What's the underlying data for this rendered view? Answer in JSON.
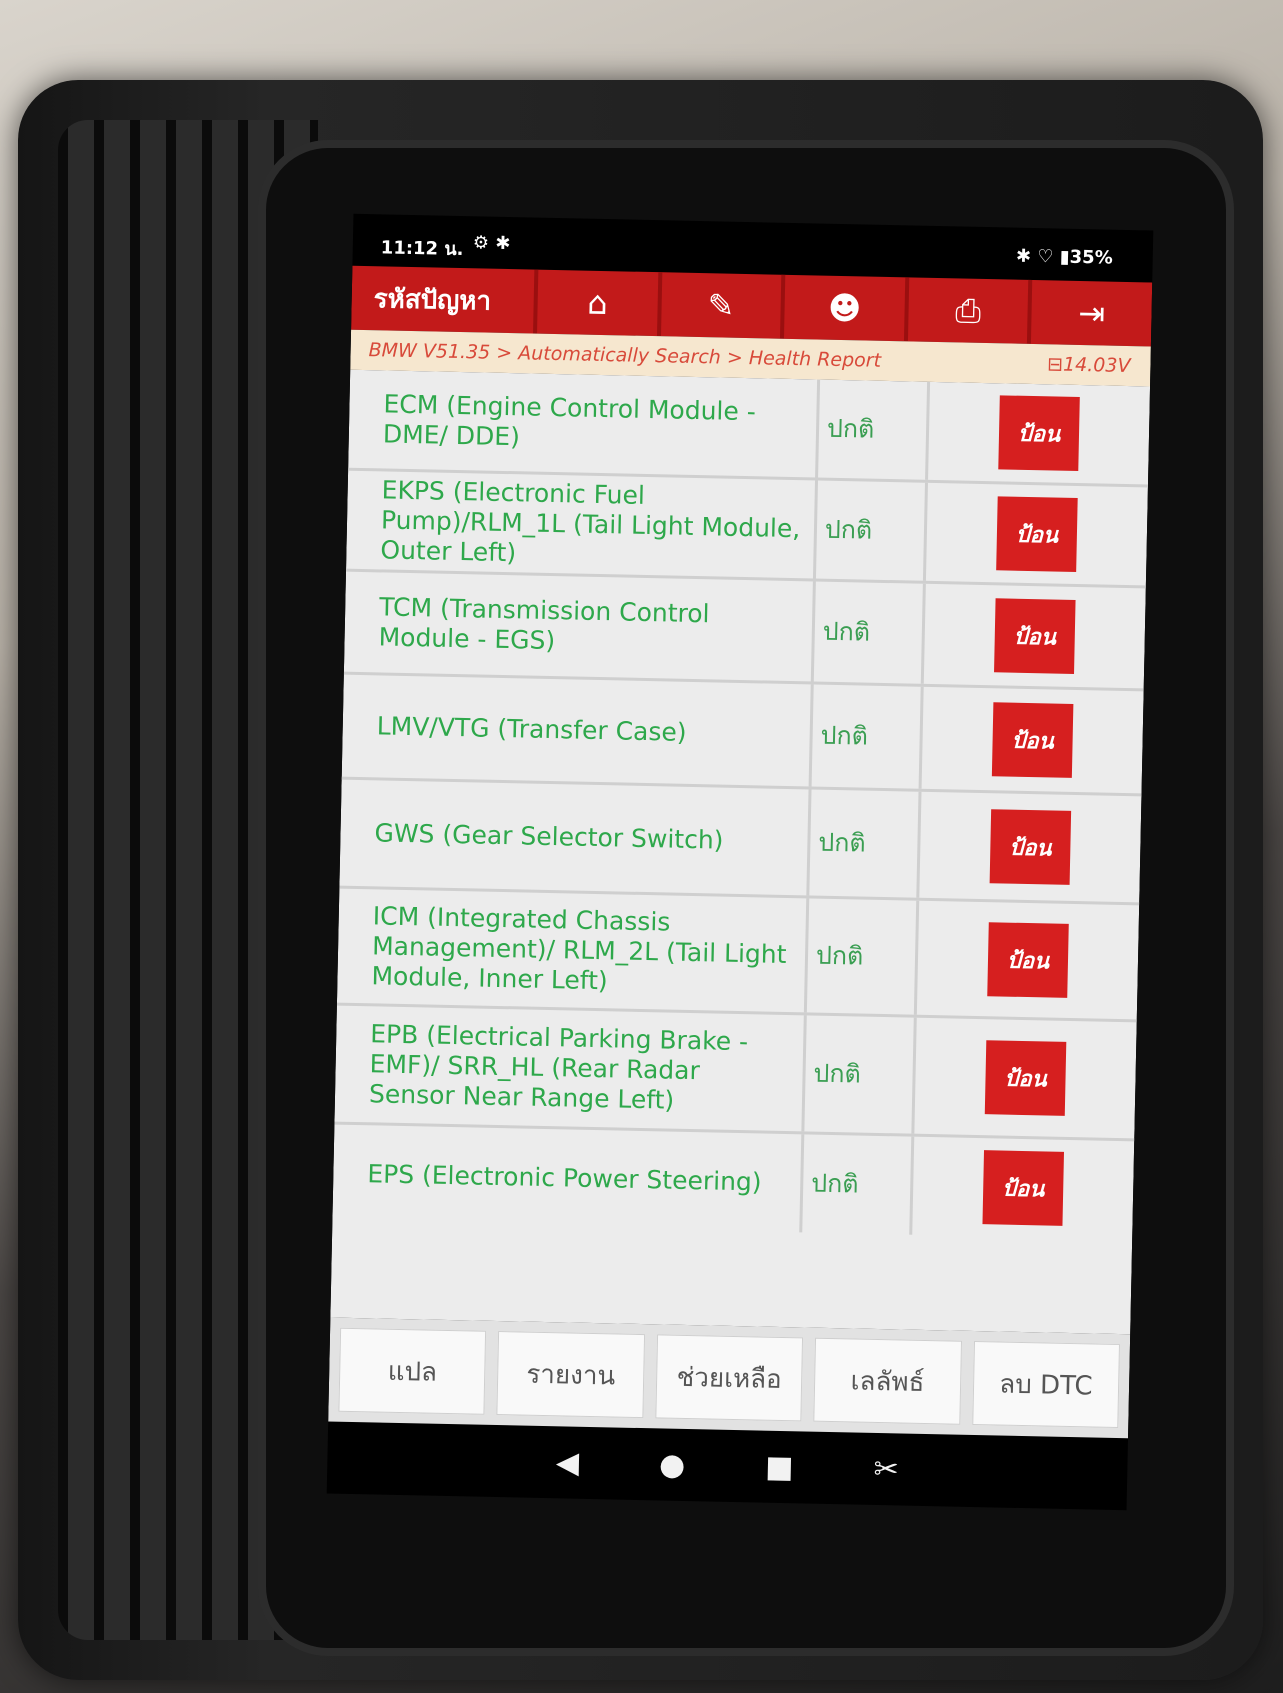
{
  "status_bar": {
    "time": "11:12 น.",
    "icons": "⚙ ✱",
    "right": "✱ ♡ ▮35%"
  },
  "toolbar": {
    "title": "รหัสปัญหา",
    "buttons": [
      {
        "icon": "home-icon",
        "glyph": "⌂"
      },
      {
        "icon": "edit-icon",
        "glyph": "✎"
      },
      {
        "icon": "user-icon",
        "glyph": "☻"
      },
      {
        "icon": "printer-icon",
        "glyph": "⎙"
      },
      {
        "icon": "exit-icon",
        "glyph": "⇥"
      }
    ]
  },
  "breadcrumb": {
    "path": "BMW V51.35 > Automatically Search > Health Report",
    "voltage": "⊟14.03V"
  },
  "modules": [
    {
      "name": "ECM (Engine Control Module - DME/ DDE)",
      "status": "ปกติ",
      "action": "ป้อน"
    },
    {
      "name": "EKPS (Electronic Fuel Pump)/RLM_1L (Tail Light Module, Outer Left)",
      "status": "ปกติ",
      "action": "ป้อน"
    },
    {
      "name": "TCM (Transmission Control Module - EGS)",
      "status": "ปกติ",
      "action": "ป้อน"
    },
    {
      "name": "LMV/VTG (Transfer Case)",
      "status": "ปกติ",
      "action": "ป้อน"
    },
    {
      "name": "GWS (Gear Selector Switch)",
      "status": "ปกติ",
      "action": "ป้อน"
    },
    {
      "name": "ICM (Integrated Chassis Management)/ RLM_2L (Tail Light Module, Inner Left)",
      "status": "ปกติ",
      "action": "ป้อน"
    },
    {
      "name": "EPB (Electrical Parking Brake - EMF)/ SRR_HL (Rear Radar Sensor Near Range Left)",
      "status": "ปกติ",
      "action": "ป้อน"
    },
    {
      "name": "EPS (Electronic Power Steering)",
      "status": "ปกติ",
      "action": "ป้อน"
    }
  ],
  "bottom_bar": {
    "buttons": [
      "แปล",
      "รายงาน",
      "ช่วยเหลือ",
      "เลลัพธ์",
      "ลบ DTC"
    ]
  },
  "nav_bar": {
    "back": "◀",
    "home": "●",
    "recents": "■",
    "screenshot": "✂"
  }
}
